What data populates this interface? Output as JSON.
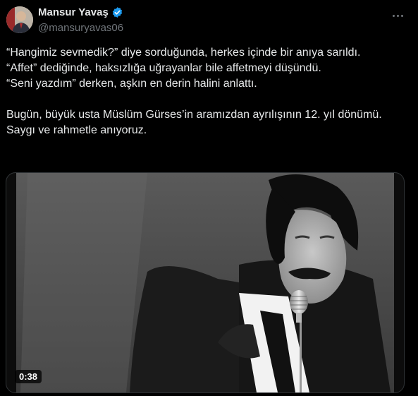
{
  "author": {
    "display_name": "Mansur Yavaş",
    "handle": "@mansuryavas06"
  },
  "tweet": {
    "lines": [
      "“Hangimiz sevmedik?” diye sorduğunda, herkes içinde bir anıya sarıldı.",
      " “Affet” dediğinde, haksızlığa uğrayanlar bile affetmeyi düşündü.",
      " “Seni yazdım” derken, aşkın en derin halini anlattı.",
      "",
      "Bugün, büyük usta Müslüm Gürses’in aramızdan ayrılışının 12. yıl dönümü.",
      "Saygı ve rahmetle anıyoruz."
    ]
  },
  "video": {
    "duration": "0:38"
  },
  "colors": {
    "background": "#000000",
    "text": "#e7e9ea",
    "secondary_text": "#71767b",
    "verified_badge": "#1d9bf0",
    "border": "#2f3336"
  }
}
